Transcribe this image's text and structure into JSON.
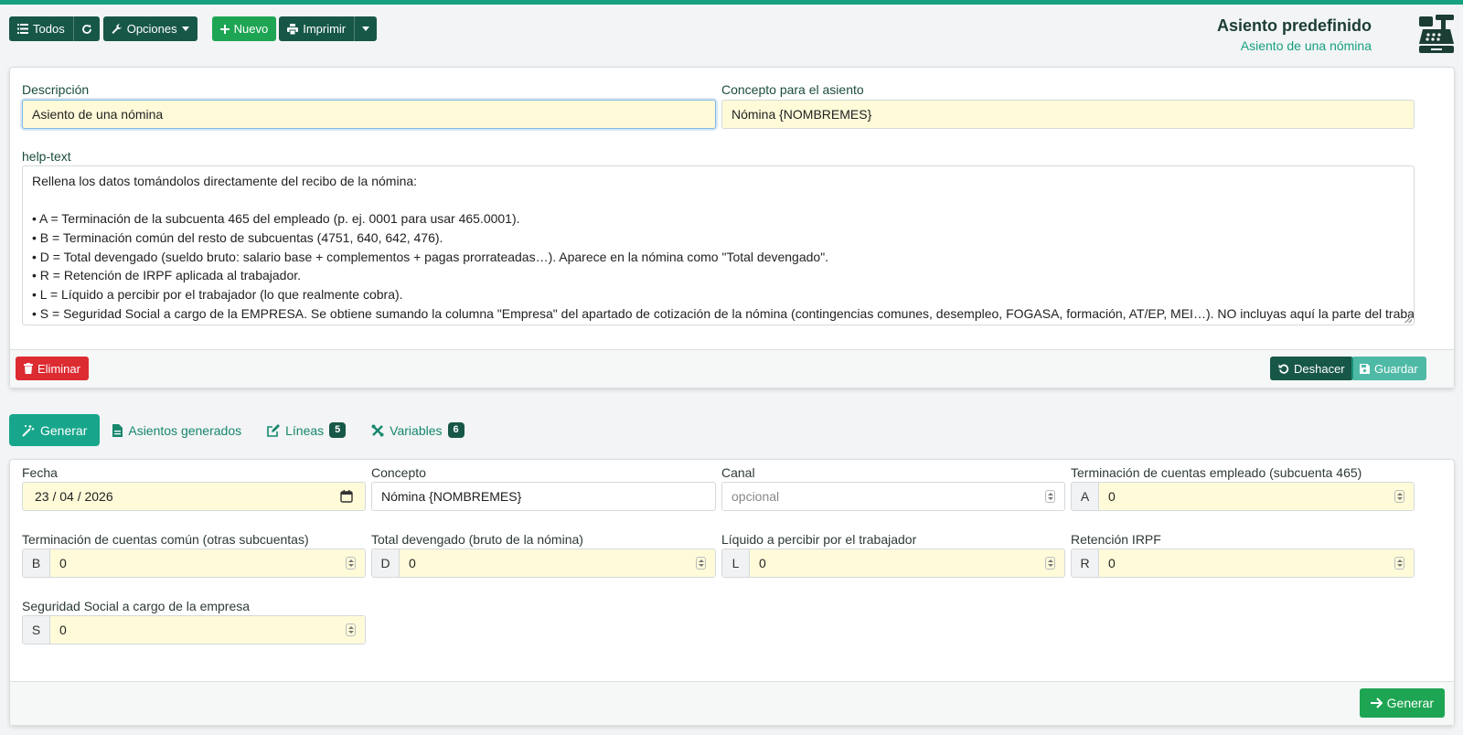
{
  "toolbar": {
    "all_label": "Todos",
    "options_label": "Opciones",
    "new_label": "Nuevo",
    "print_label": "Imprimir"
  },
  "header": {
    "title": "Asiento predefinido",
    "subtitle": "Asiento de una nómina"
  },
  "form": {
    "description_label": "Descripción",
    "description_value": "Asiento de una nómina",
    "concept_label": "Concepto para el asiento",
    "concept_value": "Nómina {NOMBREMES}",
    "help_label": "help-text",
    "help_lines": [
      "Rellena los datos tomándolos directamente del recibo de la nómina:",
      "",
      "• A = Terminación de la subcuenta 465 del empleado (p. ej. 0001 para usar 465.0001).",
      "• B = Terminación común del resto de subcuentas (4751, 640, 642, 476).",
      "• D = Total devengado (sueldo bruto: salario base + complementos + pagas prorrateadas…). Aparece en la nómina como \"Total devengado\".",
      "• R = Retención de IRPF aplicada al trabajador.",
      "• L = Líquido a percibir por el trabajador (lo que realmente cobra).",
      "• S = Seguridad Social a cargo de la EMPRESA. Se obtiene sumando la columna \"Empresa\" del apartado de cotización de la nómina (contingencias comunes, desempleo, FOGASA, formación, AT/EP, MEI…). NO incluyas aquí la parte del trabajador."
    ],
    "delete_label": "Eliminar",
    "undo_label": "Deshacer",
    "save_label": "Guardar"
  },
  "tabs": [
    {
      "label": "Generar",
      "active": true
    },
    {
      "label": "Asientos generados"
    },
    {
      "label": "Líneas",
      "badge": "5"
    },
    {
      "label": "Variables",
      "badge": "6"
    }
  ],
  "generate": {
    "date_label": "Fecha",
    "date_value": "23 / 04 / 2026",
    "concept_label": "Concepto",
    "concept_value": "Nómina {NOMBREMES}",
    "channel_label": "Canal",
    "channel_placeholder": "opcional",
    "vars": [
      {
        "label": "Terminación de cuentas empleado (subcuenta 465)",
        "prefix": "A",
        "value": "0"
      },
      {
        "label": "Terminación de cuentas común (otras subcuentas)",
        "prefix": "B",
        "value": "0"
      },
      {
        "label": "Total devengado (bruto de la nómina)",
        "prefix": "D",
        "value": "0"
      },
      {
        "label": "Líquido a percibir por el trabajador",
        "prefix": "L",
        "value": "0"
      },
      {
        "label": "Retención IRPF",
        "prefix": "R",
        "value": "0"
      },
      {
        "label": "Seguridad Social a cargo de la empresa",
        "prefix": "S",
        "value": "0"
      }
    ],
    "submit_label": "Generar"
  },
  "colors": {
    "accent": "#17a181",
    "dark": "#175747",
    "green": "#1ea553",
    "danger": "#dc2b31",
    "input_bg": "#fffbd9"
  }
}
